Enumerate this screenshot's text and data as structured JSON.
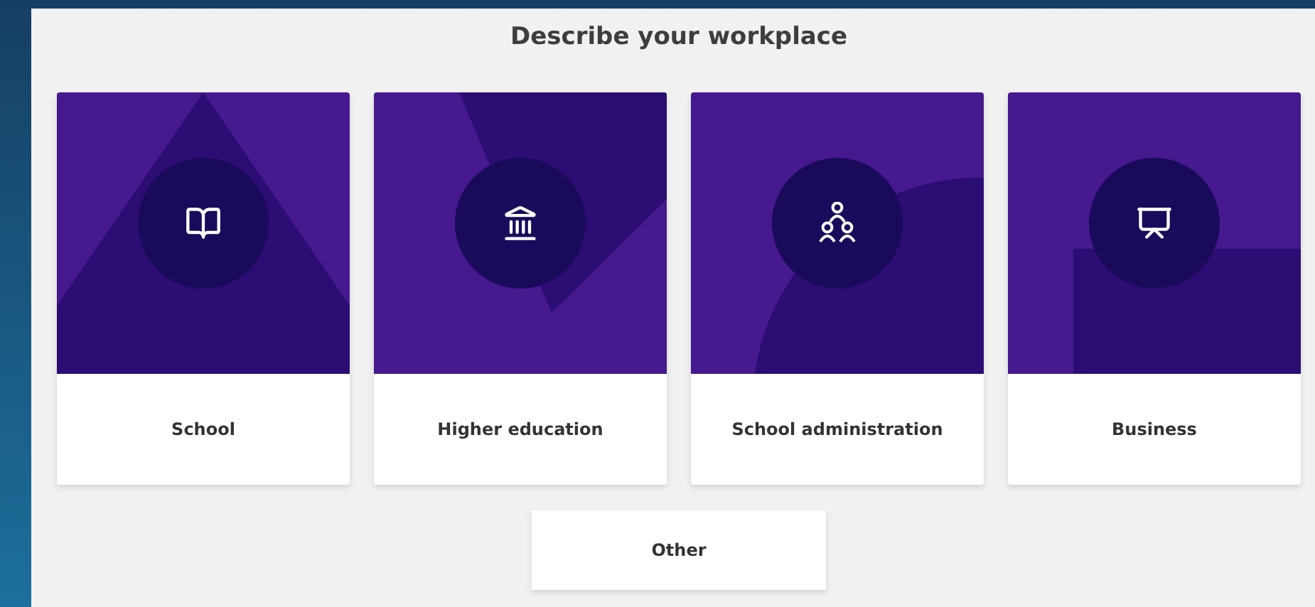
{
  "title": "Describe your workplace",
  "options": [
    {
      "label": "School",
      "kind": "book"
    },
    {
      "label": "Higher education",
      "kind": "building"
    },
    {
      "label": "School administration",
      "kind": "people"
    },
    {
      "label": "Business",
      "kind": "chart"
    }
  ],
  "other_button": "Other"
}
